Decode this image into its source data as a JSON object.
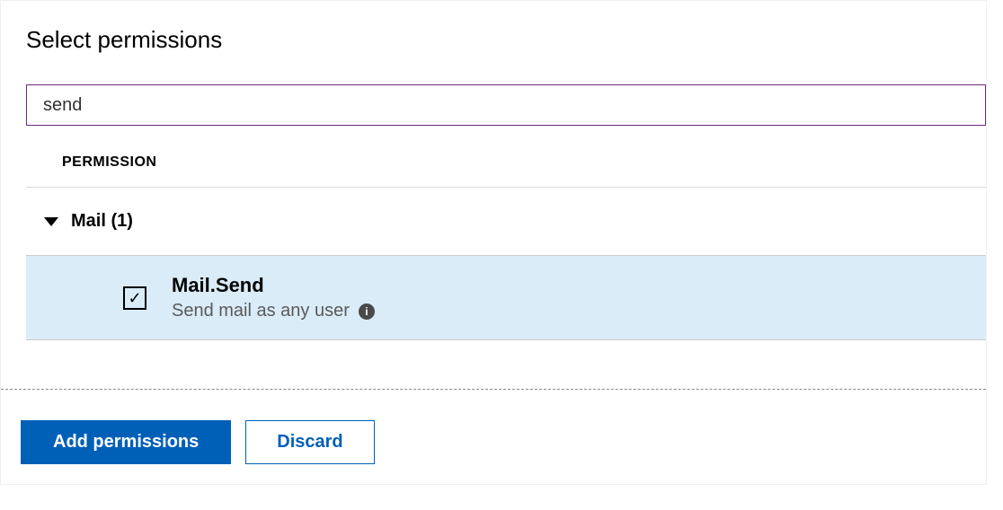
{
  "title": "Select permissions",
  "search": {
    "value": "send"
  },
  "column_header": "PERMISSION",
  "group": {
    "label": "Mail (1)"
  },
  "permission": {
    "name": "Mail.Send",
    "description": "Send mail as any user",
    "checked": true
  },
  "buttons": {
    "add": "Add permissions",
    "discard": "Discard"
  }
}
